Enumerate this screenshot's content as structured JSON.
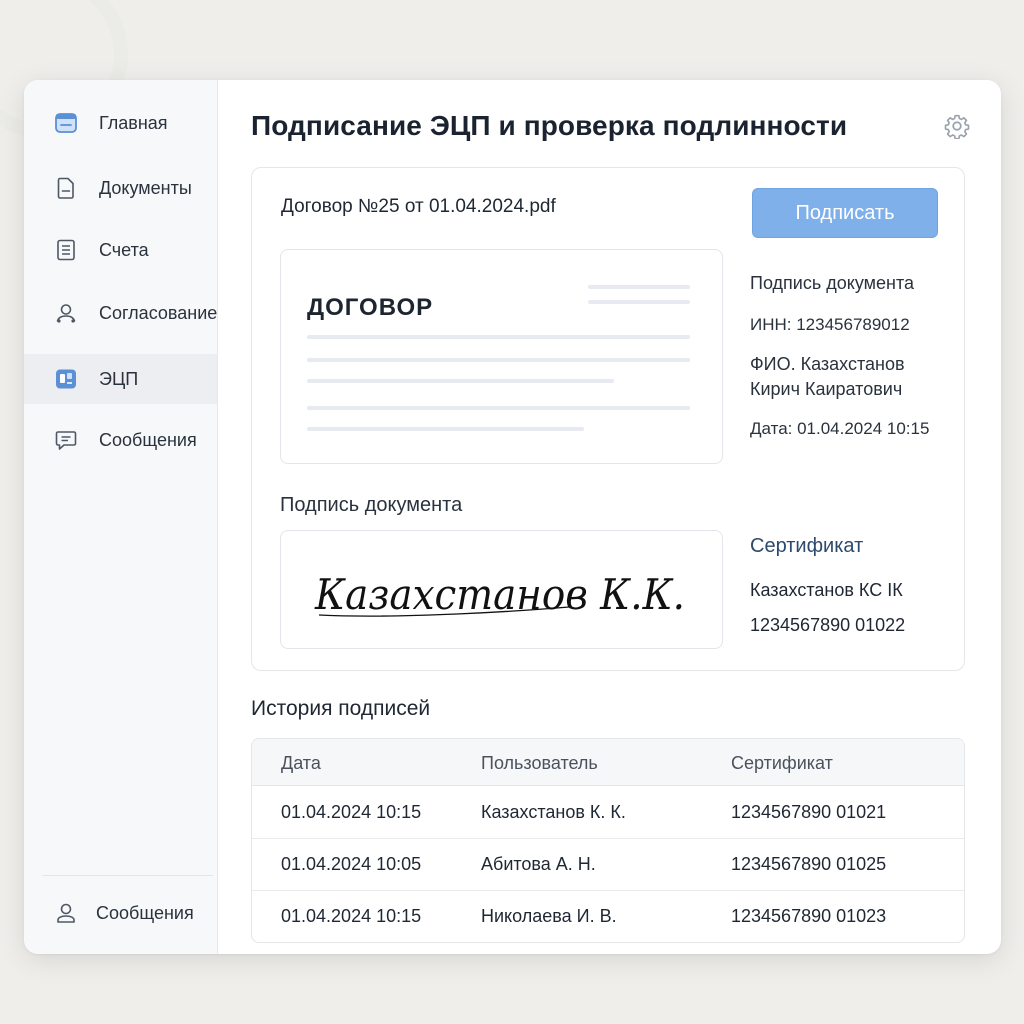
{
  "sidebar": {
    "items": [
      {
        "label": "Главная",
        "icon": "home-window-icon",
        "active": false
      },
      {
        "label": "Документы",
        "icon": "document-icon",
        "active": false
      },
      {
        "label": "Счета",
        "icon": "invoice-icon",
        "active": false
      },
      {
        "label": "Согласование",
        "icon": "approval-user-icon",
        "active": false
      },
      {
        "label": "ЭЦП",
        "icon": "digital-signature-icon",
        "active": true
      },
      {
        "label": "Сообщения",
        "icon": "message-icon",
        "active": false
      }
    ],
    "bottom": {
      "label": "Сообщения",
      "icon": "user-icon"
    }
  },
  "header": {
    "title": "Подписание ЭЦП и проверка подлинности",
    "settings_icon": "gear-icon"
  },
  "document": {
    "file_name": "Договор №25 от 01.04.2024.pdf",
    "sign_button": "Подписать",
    "preview_title": "ДОГОВОР",
    "meta_title": "Подпись документа",
    "inn": "ИНН: 123456789012",
    "fio_line1": "ФИО. Казахстанов",
    "fio_line2": "Кирич Каиратович",
    "date": "Дата: 01.04.2024 10:15",
    "signature_label": "Подпись документа",
    "signature_text": "Казахстанов К.К.",
    "certificate_title": "Сертификат",
    "certificate_owner": "Казахстанов КС ІК",
    "certificate_number": "1234567890 01022"
  },
  "history": {
    "title": "История подписей",
    "columns": [
      "Дата",
      "Пользователь",
      "Сертификат"
    ],
    "rows": [
      [
        "01.04.2024 10:15",
        "Казахстанов К. К.",
        "1234567890 01021"
      ],
      [
        "01.04.2024 10:05",
        "Абитова А. Н.",
        "1234567890 01025"
      ],
      [
        "01.04.2024 10:15",
        "Николаева И. В.",
        "1234567890 01023"
      ]
    ]
  },
  "colors": {
    "accent": "#7fb0ea",
    "icon_blue": "#5b8fd6",
    "background": "#efeeeb"
  }
}
